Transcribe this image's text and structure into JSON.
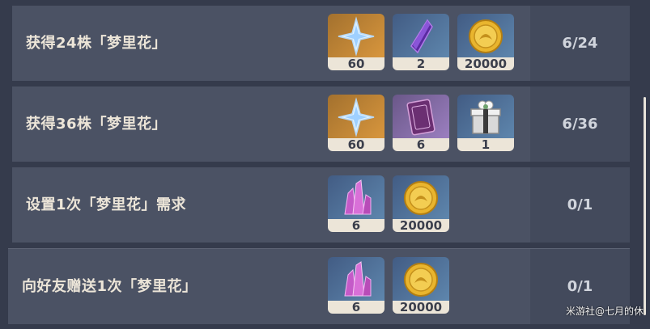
{
  "achievements": [
    {
      "label": "获得24株「梦里花」",
      "progress": "6/24",
      "rewards": [
        {
          "icon": "primogem-icon",
          "count": "60"
        },
        {
          "icon": "purple-crystal-icon",
          "count": "2"
        },
        {
          "icon": "mora-coin-icon",
          "count": "20000"
        }
      ]
    },
    {
      "label": "获得36株「梦里花」",
      "progress": "6/36",
      "rewards": [
        {
          "icon": "primogem-icon",
          "count": "60"
        },
        {
          "icon": "book-icon",
          "count": "6"
        },
        {
          "icon": "gift-box-icon",
          "count": "1"
        }
      ]
    },
    {
      "label": "设置1次「梦里花」需求",
      "progress": "0/1",
      "rewards": [
        {
          "icon": "pink-crystal-icon",
          "count": "6"
        },
        {
          "icon": "mora-coin-icon",
          "count": "20000"
        }
      ]
    },
    {
      "label": "向好友赠送1次「梦里花」",
      "progress": "0/1",
      "rewards": [
        {
          "icon": "pink-crystal-icon",
          "count": "6"
        },
        {
          "icon": "mora-coin-icon",
          "count": "20000"
        }
      ]
    }
  ],
  "watermark": "米游社@七月的休",
  "colors": {
    "row_bg": "#4b5264",
    "label": "#ece5d8",
    "count_bar": "#ece5d8"
  }
}
